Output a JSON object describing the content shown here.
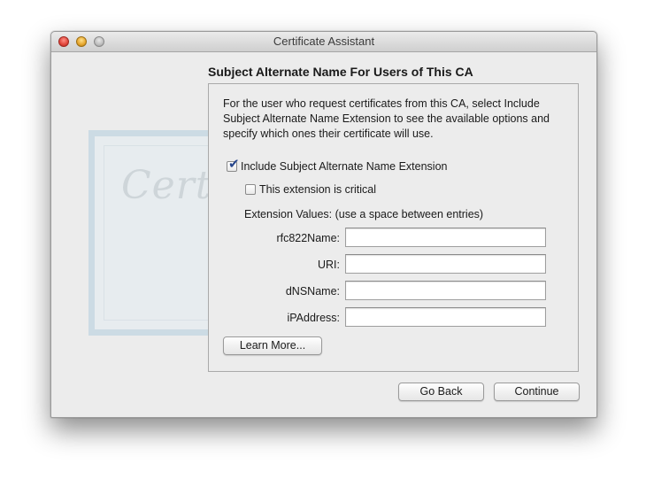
{
  "window": {
    "title": "Certificate Assistant"
  },
  "heading": "Subject Alternate Name For Users of This CA",
  "description": "For the user who request certificates from this CA, select Include Subject Alternate Name Extension to see the available options and specify which ones their certificate will use.",
  "include_extension": {
    "label": "Include Subject Alternate Name Extension",
    "checked": true
  },
  "critical_extension": {
    "label": "This extension is critical",
    "checked": false
  },
  "extension_values_label": "Extension Values: (use a space between entries)",
  "fields": [
    {
      "label": "rfc822Name:",
      "value": ""
    },
    {
      "label": "URI:",
      "value": ""
    },
    {
      "label": "dNSName:",
      "value": ""
    },
    {
      "label": "iPAddress:",
      "value": ""
    }
  ],
  "buttons": {
    "learn_more": "Learn More...",
    "go_back": "Go Back",
    "continue": "Continue"
  },
  "icons": {
    "checkmark": "checkmark-icon",
    "close": "close-icon",
    "minimize": "minimize-icon",
    "zoom": "zoom-icon"
  },
  "colors": {
    "window_bg": "#ececec",
    "checkmark": "#27468c"
  }
}
